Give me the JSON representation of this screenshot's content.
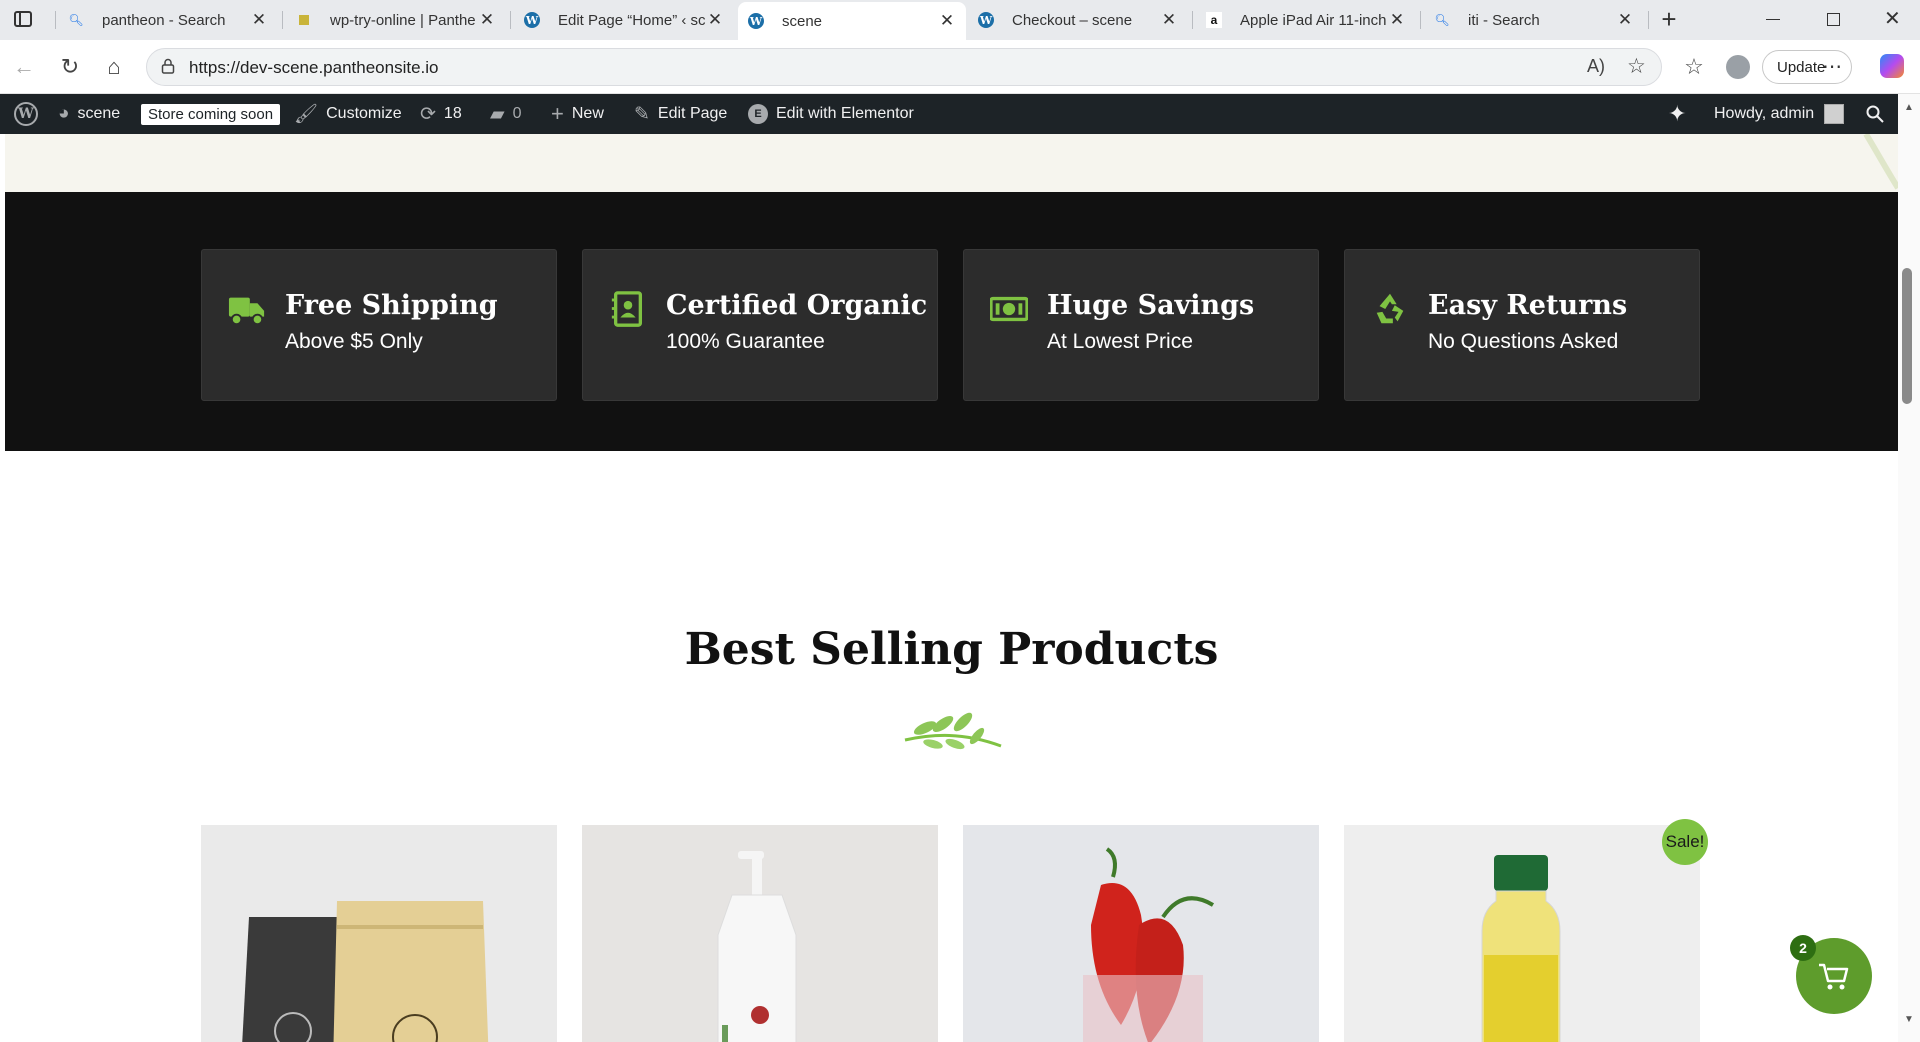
{
  "browser": {
    "tabs": [
      {
        "title": "pantheon - Search",
        "icon": "search-icon"
      },
      {
        "title": "wp-try-online | Panthe",
        "icon": "pantheon-icon"
      },
      {
        "title": "Edit Page “Home” ‹ sce",
        "icon": "wordpress-icon"
      },
      {
        "title": "scene",
        "icon": "wordpress-icon",
        "active": true
      },
      {
        "title": "Checkout – scene",
        "icon": "wordpress-icon"
      },
      {
        "title": "Apple iPad Air 11-inch",
        "icon": "amazon-icon"
      },
      {
        "title": "iti - Search",
        "icon": "search-icon"
      }
    ],
    "url": "https://dev-scene.pantheonsite.io",
    "update_label": "Update"
  },
  "adminbar": {
    "site_name": "scene",
    "store_badge": "Store coming soon",
    "customize": "Customize",
    "updates_count": "18",
    "comments_count": "0",
    "new_label": "New",
    "edit_page": "Edit Page",
    "edit_elementor": "Edit with Elementor",
    "howdy": "Howdy, admin"
  },
  "features": [
    {
      "title": "Free Shipping",
      "subtitle": "Above $5 Only",
      "icon": "truck-icon"
    },
    {
      "title": "Certified Organic",
      "subtitle": "100% Guarantee",
      "icon": "certificate-icon"
    },
    {
      "title": "Huge Savings",
      "subtitle": "At Lowest Price",
      "icon": "money-icon"
    },
    {
      "title": "Easy Returns",
      "subtitle": "No Questions Asked",
      "icon": "recycle-icon"
    }
  ],
  "best_selling": {
    "title": "Best Selling Products",
    "sale_badge": "Sale!"
  },
  "cart": {
    "count": "2"
  },
  "colors": {
    "accent_green": "#7fc242",
    "dark_section": "#111111",
    "card": "#2c2c2c",
    "adminbar": "#1d2327"
  }
}
